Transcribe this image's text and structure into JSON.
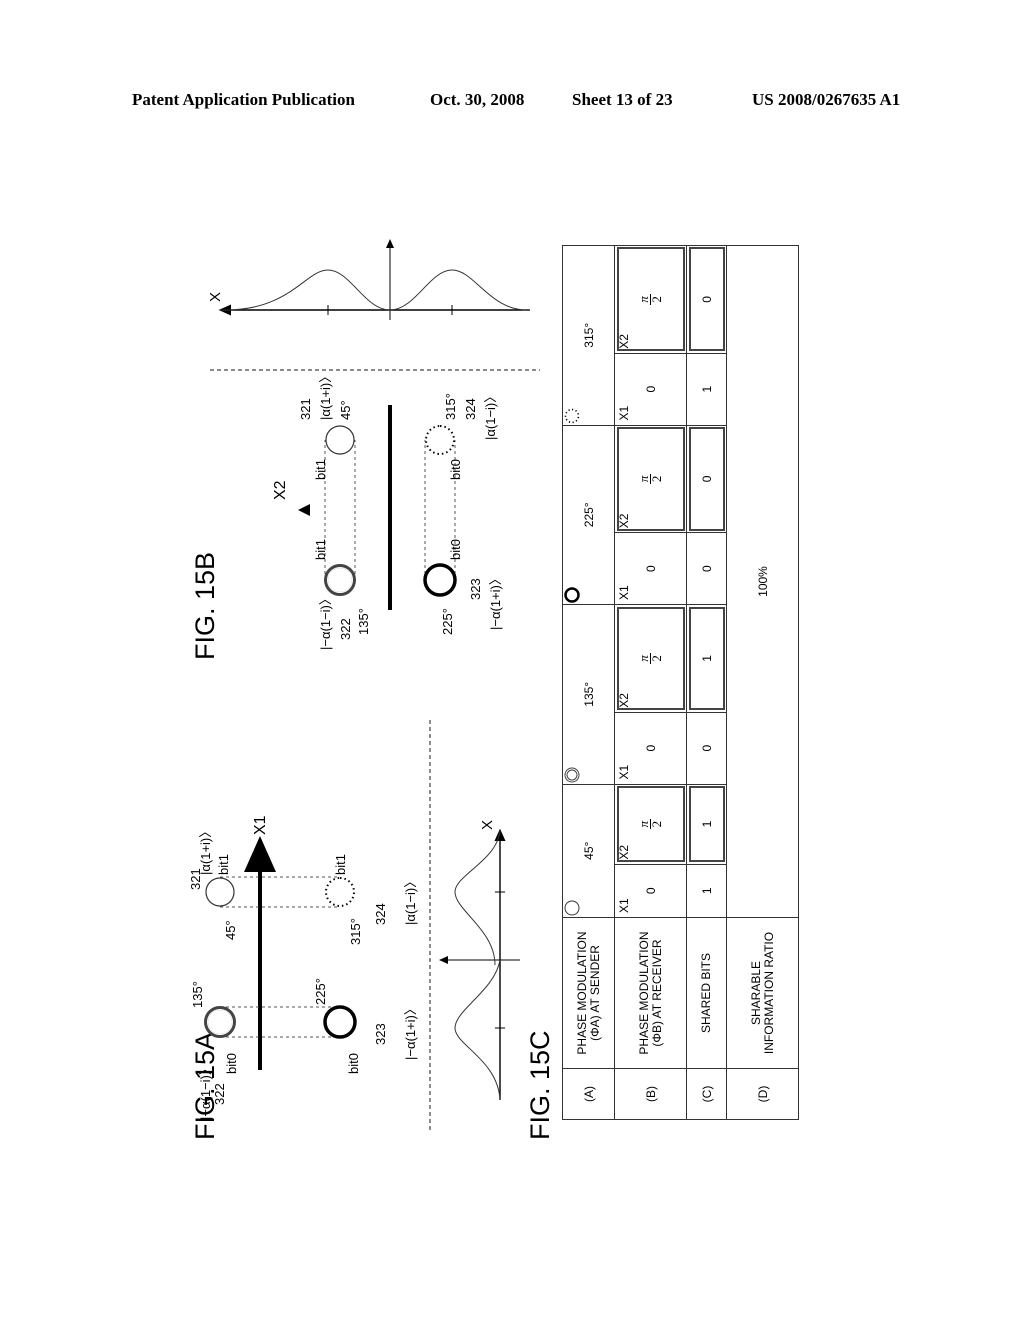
{
  "header": {
    "publication": "Patent Application Publication",
    "date": "Oct. 30, 2008",
    "sheet": "Sheet 13 of 23",
    "patent_number": "US 2008/0267635 A1"
  },
  "fig15a": {
    "title": "FIG. 15A",
    "axis_label": "X1",
    "dist_axis_label": "X",
    "states": [
      {
        "ref": "321",
        "angle": "45°",
        "bit": "bit1",
        "ket": "|α(1+i)〉",
        "style": "thin"
      },
      {
        "ref": "322",
        "angle": "135°",
        "bit": "bit0",
        "ket": "|−α(1−i)〉",
        "style": "double"
      },
      {
        "ref": "323",
        "angle": "225°",
        "bit": "bit0",
        "ket": "|−α(1+i)〉",
        "style": "bold"
      },
      {
        "ref": "324",
        "angle": "315°",
        "bit": "bit1",
        "ket": "|α(1−i)〉",
        "style": "dotted"
      }
    ]
  },
  "fig15b": {
    "title": "FIG. 15B",
    "axis_label": "X2",
    "dist_axis_label": "X",
    "states": [
      {
        "ref": "321",
        "angle": "45°",
        "bit": "bit1",
        "ket": "|α(1+i)〉",
        "style": "thin"
      },
      {
        "ref": "322",
        "angle": "135°",
        "bit": "bit1",
        "ket": "|−α(1−i)〉",
        "style": "double"
      },
      {
        "ref": "323",
        "angle": "225°",
        "bit": "bit0",
        "ket": "|−α(1+i)〉",
        "style": "bold"
      },
      {
        "ref": "324",
        "angle": "315°",
        "bit": "bit0",
        "ket": "|α(1−i)〉",
        "style": "dotted"
      }
    ]
  },
  "fig15c": {
    "title": "FIG. 15C",
    "rows": [
      {
        "id": "(A)",
        "label_line1": "PHASE MODULATION",
        "label_line2": "(ΦA) AT SENDER"
      },
      {
        "id": "(B)",
        "label_line1": "PHASE MODULATION",
        "label_line2": "(ΦB) AT RECEIVER"
      },
      {
        "id": "(C)",
        "label_line1": "SHARED BITS",
        "label_line2": ""
      },
      {
        "id": "(D)",
        "label_line1": "SHARABLE",
        "label_line2": "INFORMATION RATIO"
      }
    ],
    "columns": [
      {
        "angle": "45°",
        "symbol": "thin-circle",
        "x1": {
          "label": "X1",
          "phase": "0",
          "shared": "1"
        },
        "x2": {
          "label": "X2",
          "phase_num": "π",
          "phase_den": "2",
          "shared": "1"
        }
      },
      {
        "angle": "135°",
        "symbol": "double-circle",
        "x1": {
          "label": "X1",
          "phase": "0",
          "shared": "0"
        },
        "x2": {
          "label": "X2",
          "phase_num": "π",
          "phase_den": "2",
          "shared": "1"
        }
      },
      {
        "angle": "225°",
        "symbol": "bold-circle",
        "x1": {
          "label": "X1",
          "phase": "0",
          "shared": "0"
        },
        "x2": {
          "label": "X2",
          "phase_num": "π",
          "phase_den": "2",
          "shared": "0"
        }
      },
      {
        "angle": "315°",
        "symbol": "dotted-circle",
        "x1": {
          "label": "X1",
          "phase": "0",
          "shared": "1"
        },
        "x2": {
          "label": "X2",
          "phase_num": "π",
          "phase_den": "2",
          "shared": "0"
        }
      }
    ],
    "sharable_ratio": "100%"
  }
}
